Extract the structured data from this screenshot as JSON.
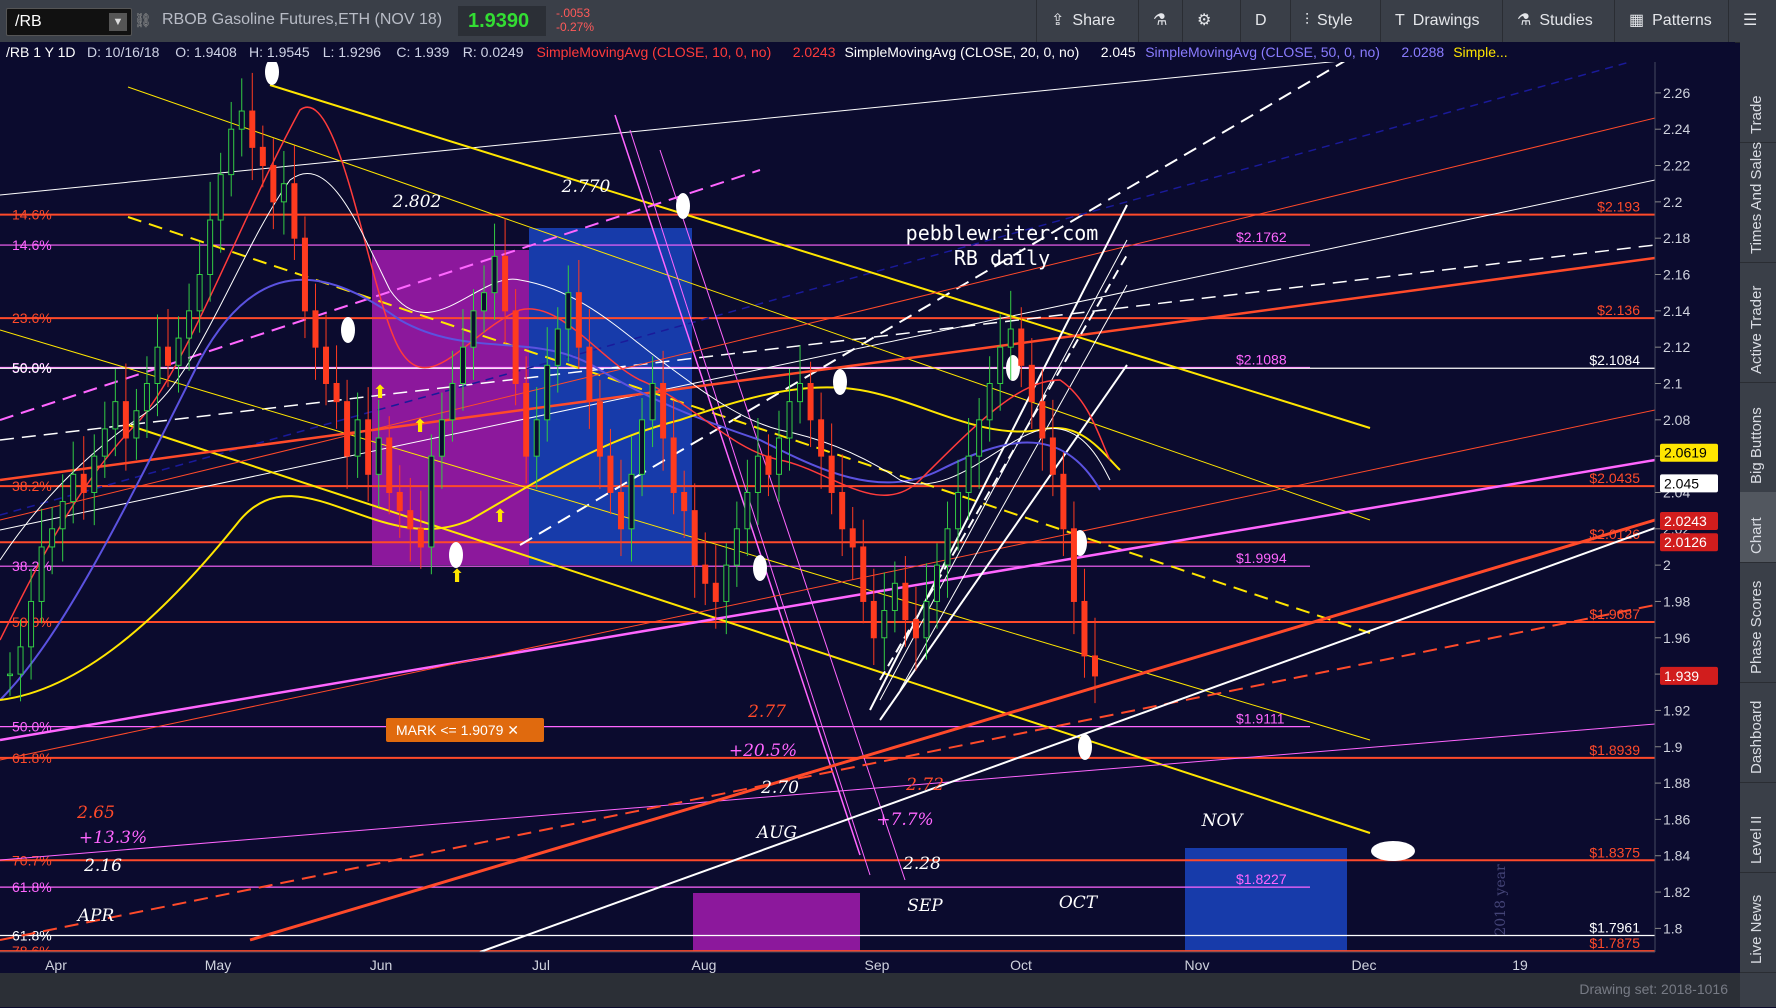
{
  "toolbar": {
    "symbol": "/RB",
    "title": "RBOB Gasoline Futures,ETH (NOV 18)",
    "last": "1.9390",
    "change": "-.0053",
    "change_pct": "-0.27%",
    "buttons": [
      "Share",
      "Drawings",
      "Style",
      "Studies",
      "Patterns",
      "D"
    ]
  },
  "header": {
    "label": "/RB 1 Y 1D",
    "date": "D: 10/16/18",
    "open": "O: 1.9408",
    "high": "H: 1.9545",
    "low": "L: 1.9296",
    "close": "C: 1.939",
    "range": "R: 0.0249",
    "sma10": "SimpleMovingAvg (CLOSE, 10, 0, no)",
    "sma10_val": "2.0243",
    "sma20": "SimpleMovingAvg (CLOSE, 20, 0, no)",
    "sma20_val": "2.045",
    "sma50": "SimpleMovingAvg (CLOSE, 50, 0, no)",
    "sma50_val": "2.0288",
    "more": "Simple..."
  },
  "sidebar": {
    "tabs": [
      "Trade",
      "Times And Sales",
      "Active Trader",
      "Big Buttons",
      "Chart",
      "Phase Scores",
      "Dashboard",
      "Level II",
      "Live News"
    ]
  },
  "status": {
    "drawing_set": "Drawing set: 2018-1016"
  },
  "chart_data": {
    "type": "candlestick",
    "title": "pebblewriter.com",
    "subtitle": "RB daily",
    "x_labels": [
      "Apr",
      "May",
      "Jun",
      "Jul",
      "Aug",
      "Sep",
      "Oct",
      "Nov",
      "Dec",
      "19"
    ],
    "y_ticks": [
      "2.26",
      "2.24",
      "2.22",
      "2.2",
      "2.18",
      "2.16",
      "2.14",
      "2.12",
      "2.1",
      "2.08",
      "2.06",
      "2.04",
      "2.02",
      "2",
      "1.98",
      "1.96",
      "1.94",
      "1.92",
      "1.9",
      "1.88",
      "1.86",
      "1.84",
      "1.82",
      "1.8"
    ],
    "ylim": [
      1.787,
      2.277
    ],
    "price_tags": [
      {
        "value": 2.0619,
        "label": "2.0619",
        "bg": "#ffe600",
        "fg": "#000000"
      },
      {
        "value": 2.045,
        "label": "2.045",
        "bg": "#ffffff",
        "fg": "#000000"
      },
      {
        "value": 2.0243,
        "label": "2.0243",
        "bg": "#d11d1d",
        "fg": "#ffffff"
      },
      {
        "value": 2.0126,
        "label": "2.0126",
        "bg": "#d11d1d",
        "fg": "#ffffff"
      },
      {
        "value": 1.939,
        "label": "1.939",
        "bg": "#d11d1d",
        "fg": "#ffffff"
      }
    ],
    "fib_levels": [
      {
        "value": 2.193,
        "left": "14.6%",
        "right": "$2.193",
        "color": "#ff4a2a"
      },
      {
        "value": 2.1762,
        "left": "14.6%",
        "mid": "$2.1762",
        "color": "#ff66ff"
      },
      {
        "value": 2.136,
        "left": "23.6%",
        "right": "$2.136",
        "color": "#ff4a2a"
      },
      {
        "value": 2.1088,
        "left": "50.0%",
        "mid": "$2.1088",
        "color": "#ff66ff"
      },
      {
        "value": 2.1084,
        "left": "50.0%",
        "right": "$2.1084",
        "color": "#ffffff"
      },
      {
        "value": 2.0435,
        "left": "38.2%",
        "right": "$2.0435",
        "color": "#ff4a2a"
      },
      {
        "value": 2.0126,
        "left": "",
        "right": "$2.0126",
        "color": "#ff4a2a"
      },
      {
        "value": 1.9994,
        "left": "38.2%",
        "mid": "$1.9994",
        "color": "#ff66ff"
      },
      {
        "value": 1.9687,
        "left": "50.0%",
        "right": "$1.9687",
        "color": "#ff4a2a"
      },
      {
        "value": 1.9111,
        "left": "50.0%",
        "mid": "$1.9111",
        "color": "#ff66ff"
      },
      {
        "value": 1.8939,
        "left": "61.8%",
        "right": "$1.8939",
        "color": "#ff4a2a"
      },
      {
        "value": 1.8375,
        "left": "70.7%",
        "right": "$1.8375",
        "color": "#ff4a2a"
      },
      {
        "value": 1.8227,
        "left": "61.8%",
        "mid": "$1.8227",
        "color": "#ff66ff"
      },
      {
        "value": 1.7961,
        "left": "61.8%",
        "right": "$1.7961",
        "color": "#ffffff"
      },
      {
        "value": 1.7875,
        "left": "78.6%",
        "right": "$1.7875",
        "color": "#ff4a2a"
      }
    ],
    "annotations": [
      "2.802",
      "2.770",
      "2.77",
      "+20.5%",
      "2.70",
      "2.72",
      "AUG",
      "+7.7%",
      "2.28",
      "SEP",
      "OCT",
      "NOV",
      "2.65",
      "+13.3%",
      "2.16",
      "APR",
      "2018 year"
    ],
    "mark_label": "MARK <= 1.9079",
    "close_series": [
      1.94,
      1.955,
      1.98,
      2.01,
      2.02,
      2.035,
      2.05,
      2.04,
      2.06,
      2.075,
      2.09,
      2.07,
      2.085,
      2.1,
      2.12,
      2.11,
      2.125,
      2.14,
      2.16,
      2.19,
      2.215,
      2.24,
      2.25,
      2.23,
      2.22,
      2.2,
      2.21,
      2.18,
      2.14,
      2.12,
      2.1,
      2.09,
      2.06,
      2.08,
      2.05,
      2.07,
      2.04,
      2.03,
      2.02,
      2.01,
      2.06,
      2.08,
      2.1,
      2.12,
      2.14,
      2.15,
      2.17,
      2.14,
      2.1,
      2.06,
      2.08,
      2.11,
      2.13,
      2.15,
      2.12,
      2.09,
      2.06,
      2.04,
      2.02,
      2.05,
      2.08,
      2.1,
      2.07,
      2.04,
      2.03,
      2.0,
      1.99,
      1.98,
      2.0,
      2.02,
      2.04,
      2.06,
      2.05,
      2.07,
      2.09,
      2.1,
      2.08,
      2.06,
      2.04,
      2.02,
      2.01,
      1.98,
      1.96,
      1.975,
      1.99,
      1.97,
      1.96,
      1.98,
      2.0,
      2.02,
      2.04,
      2.06,
      2.08,
      2.1,
      2.12,
      2.13,
      2.11,
      2.09,
      2.07,
      2.05,
      2.02,
      1.98,
      1.95,
      1.939
    ]
  }
}
